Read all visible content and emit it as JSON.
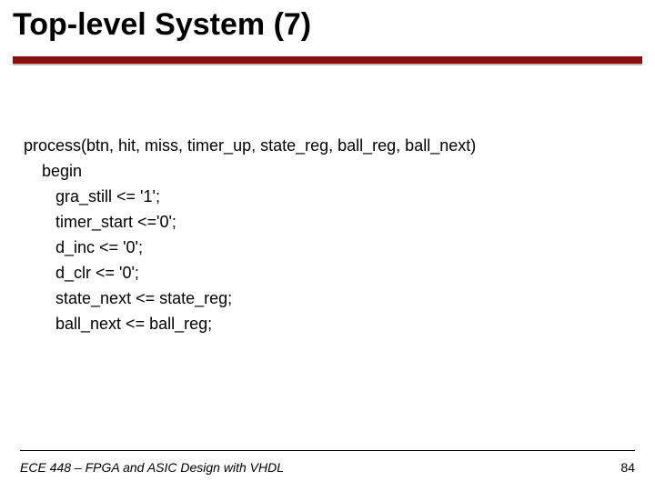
{
  "title": "Top-level System (7)",
  "code": {
    "l1": "process(btn, hit, miss, timer_up, state_reg, ball_reg, ball_next)",
    "l2": "    begin",
    "l3": "       gra_still <= '1';",
    "l4": "       timer_start <='0';",
    "l5": "       d_inc <= '0';",
    "l6": "       d_clr <= '0';",
    "l7": "       state_next <= state_reg;",
    "l8": "       ball_next <= ball_reg;"
  },
  "footer": {
    "course": "ECE 448 – FPGA and ASIC Design with VHDL",
    "page": "84"
  }
}
